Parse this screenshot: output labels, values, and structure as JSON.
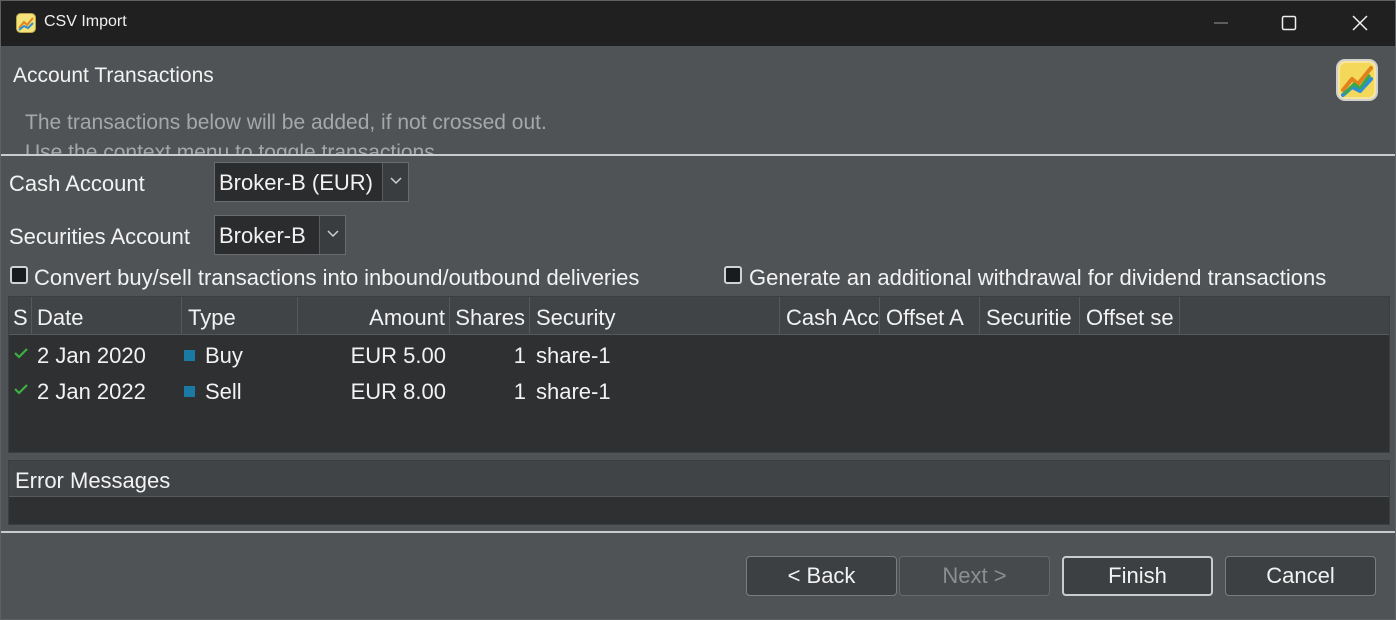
{
  "window": {
    "title": "CSV Import"
  },
  "header": {
    "title": "Account Transactions",
    "description_line1": "The transactions below will be added, if not crossed out.",
    "description_line2": "Use the context menu to toggle transactions."
  },
  "form": {
    "cash_account_label": "Cash Account",
    "cash_account_value": "Broker-B (EUR)",
    "securities_account_label": "Securities Account",
    "securities_account_value": "Broker-B",
    "convert_label": "Convert buy/sell transactions into inbound/outbound deliveries",
    "convert_checked": false,
    "withdrawal_label": "Generate an additional withdrawal for dividend transactions",
    "withdrawal_checked": false
  },
  "table": {
    "columns": [
      "S",
      "Date",
      "Type",
      "Amount",
      "Shares",
      "Security",
      "Cash Acc",
      "Offset A",
      "Securitie",
      "Offset se"
    ],
    "rows": [
      {
        "status": "ok",
        "date": "2 Jan 2020",
        "type": "Buy",
        "amount": "EUR 5.00",
        "shares": "1",
        "security": "share-1"
      },
      {
        "status": "ok",
        "date": "2 Jan 2022",
        "type": "Sell",
        "amount": "EUR 8.00",
        "shares": "1",
        "security": "share-1"
      }
    ]
  },
  "errors": {
    "title": "Error Messages"
  },
  "buttons": {
    "back": "< Back",
    "next": "Next >",
    "finish": "Finish",
    "cancel": "Cancel"
  },
  "colors": {
    "accent_check": "#3cb043",
    "type_marker": "#1a7aa4",
    "titlebar": "#202020",
    "background": "#4f5356"
  },
  "icons": [
    "app-icon",
    "minimize-icon",
    "maximize-icon",
    "close-icon",
    "logo-icon",
    "chevron-down-icon",
    "checkmark-icon",
    "type-marker-icon"
  ]
}
